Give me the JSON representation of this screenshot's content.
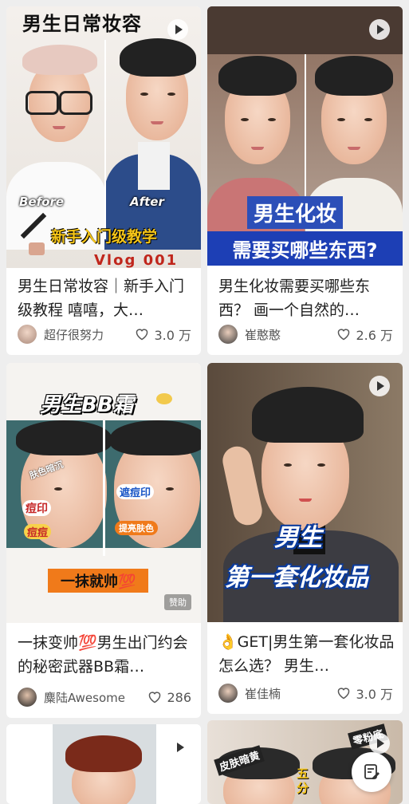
{
  "feed": {
    "cards": [
      {
        "thumb": {
          "top_text": "男生日常妆容",
          "before": "Before",
          "after": "After",
          "banner": "新手入门级教学",
          "vlog": "Vlog 001"
        },
        "title": "男生日常妆容｜新手入门级教程 嘻嘻，大…",
        "author": "超仔很努力",
        "likes": "3.0 万"
      },
      {
        "thumb": {
          "banner1": "男生化妆",
          "banner2": "需要买哪些东西?"
        },
        "title": "男生化妆需要买哪些东西？ 画一个自然的…",
        "author": "崔憨憨",
        "likes": "2.6 万"
      },
      {
        "thumb": {
          "top_text": "男生BB霜",
          "left_label1": "肤色暗沉",
          "left_label2": "痘印",
          "left_label3": "痘痘",
          "right_label1": "遮痘印",
          "right_label2": "提亮肤色",
          "banner": "一抹就帅💯",
          "sponsored": "赞助"
        },
        "title": "一抹变帅💯男生出门约会的秘密武器BB霜…",
        "author": "麋陆Awesome",
        "likes": "286"
      },
      {
        "thumb": {
          "banner1": "男生",
          "banner2": "第一套化妆品"
        },
        "title": "👌GET|男生第一套化妆品怎么选？ 男生…",
        "author": "崔佳楠",
        "likes": "3.0 万"
      },
      {
        "thumb": {}
      },
      {
        "thumb": {
          "tag1": "皮肤暗黄",
          "tag2": "五分",
          "tag3": "零粉底"
        }
      }
    ]
  },
  "colors": {
    "accent": "#0a3a9c",
    "banner_blue": "#1d3fb5",
    "orange": "#f07a1a"
  },
  "icons": {
    "play": "play-icon",
    "like": "heart-outline-icon",
    "compose": "edit-note-icon"
  }
}
